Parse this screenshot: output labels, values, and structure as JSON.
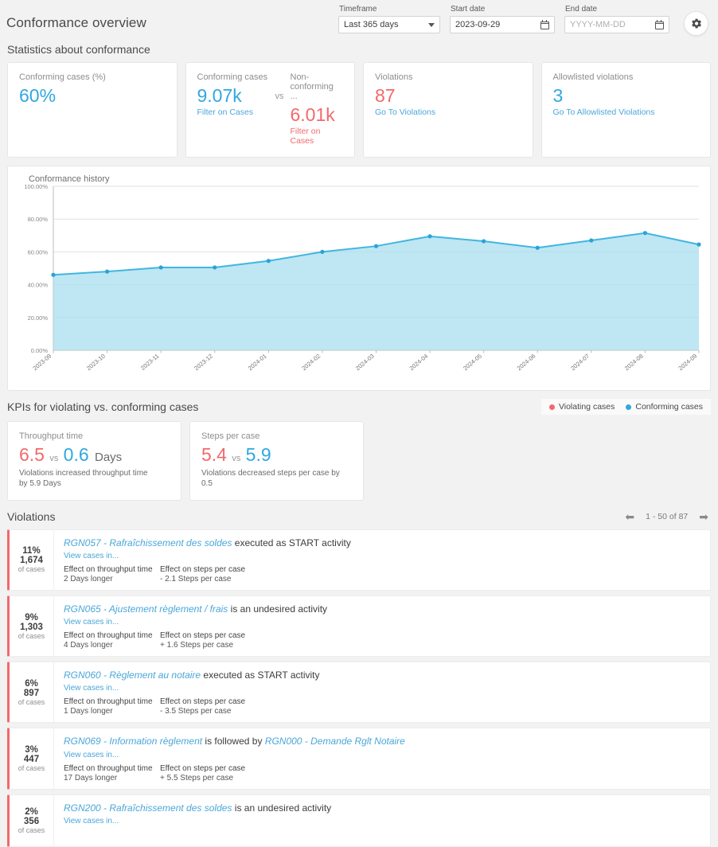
{
  "header": {
    "title": "Conformance overview",
    "timeframe": {
      "label": "Timeframe",
      "value": "Last 365 days"
    },
    "start_date": {
      "label": "Start date",
      "value": "2023-09-29",
      "placeholder": "YYYY-MM-DD"
    },
    "end_date": {
      "label": "End date",
      "value": "",
      "placeholder": "YYYY-MM-DD"
    },
    "settings_icon": "gear-icon"
  },
  "stats": {
    "title": "Statistics about conformance",
    "conforming_pct": {
      "label": "Conforming cases (%)",
      "value": "60%"
    },
    "conforming_cases": {
      "label": "Conforming cases",
      "value": "9.07k",
      "link": "Filter on Cases"
    },
    "vs": "vs",
    "non_conforming_cases": {
      "label": "Non-conforming ...",
      "value": "6.01k",
      "link": "Filter on Cases"
    },
    "violations": {
      "label": "Violations",
      "value": "87",
      "link": "Go To Violations"
    },
    "allowlisted": {
      "label": "Allowlisted violations",
      "value": "3",
      "link": "Go To Allowlisted Violations"
    }
  },
  "chart_data": {
    "type": "area",
    "title": "Conformance history",
    "xlabel": "",
    "ylabel": "",
    "ylim": [
      0,
      100
    ],
    "ytick_labels": [
      "0.00%",
      "20.00%",
      "40.00%",
      "60.00%",
      "80.00%",
      "100.00%"
    ],
    "yticks": [
      0,
      20,
      40,
      60,
      80,
      100
    ],
    "grid": true,
    "legend": "none",
    "categories": [
      "2023-09",
      "2023-10",
      "2023-11",
      "2023-12",
      "2024-01",
      "2024-02",
      "2024-03",
      "2024-04",
      "2024-05",
      "2024-06",
      "2024-07",
      "2024-08",
      "2024-09"
    ],
    "series": [
      {
        "name": "Conformance",
        "values": [
          46.0,
          48.0,
          50.5,
          50.5,
          54.5,
          60.0,
          63.5,
          69.5,
          66.5,
          62.5,
          67.0,
          71.5,
          64.5
        ]
      }
    ],
    "line_color": "#41b6e0",
    "fill_color": "#a9ddef"
  },
  "kpis": {
    "title": "KPIs for violating vs. conforming cases",
    "legend": [
      {
        "label": "Violating cases",
        "color": "#f2696b"
      },
      {
        "label": "Conforming cases",
        "color": "#2fa8e0"
      }
    ],
    "cards": [
      {
        "label": "Throughput time",
        "violating": "6.5",
        "vs": "vs",
        "conforming": "0.6",
        "unit": "Days",
        "note": "Violations increased throughput time by 5.9 Days"
      },
      {
        "label": "Steps per case",
        "violating": "5.4",
        "vs": "vs",
        "conforming": "5.9",
        "unit": "",
        "note": "Violations decreased steps per case by 0.5"
      }
    ]
  },
  "violations": {
    "title": "Violations",
    "pagination": {
      "prev_icon": "arrow-left-icon",
      "range": "1 - 50 of 87",
      "next_icon": "arrow-right-icon"
    },
    "view_cases_link": "View cases in...",
    "effect_throughput_header": "Effect on throughput time",
    "effect_steps_header": "Effect on steps per case",
    "items": [
      {
        "pct": "11%",
        "count": "1,674",
        "of_cases": "of cases",
        "rule": "RGN057 - Rafraîchissement des soldes",
        "desc_after": " executed as START activity",
        "rule2": "",
        "desc_mid": "",
        "throughput": "2 Days longer",
        "steps": "- 2.1 Steps per case"
      },
      {
        "pct": "9%",
        "count": "1,303",
        "of_cases": "of cases",
        "rule": "RGN065 - Ajustement règlement / frais",
        "desc_after": " is an undesired activity",
        "rule2": "",
        "desc_mid": "",
        "throughput": "4 Days longer",
        "steps": "+ 1.6 Steps per case"
      },
      {
        "pct": "6%",
        "count": "897",
        "of_cases": "of cases",
        "rule": "RGN060 - Règlement au notaire",
        "desc_after": " executed as START activity",
        "rule2": "",
        "desc_mid": "",
        "throughput": "1 Days longer",
        "steps": "- 3.5 Steps per case"
      },
      {
        "pct": "3%",
        "count": "447",
        "of_cases": "of cases",
        "rule": "RGN069 - Information règlement",
        "desc_mid": " is followed by ",
        "rule2": "RGN000 - Demande Rglt Notaire",
        "desc_after": "",
        "throughput": "17 Days longer",
        "steps": "+ 5.5 Steps per case"
      },
      {
        "pct": "2%",
        "count": "356",
        "of_cases": "of cases",
        "rule": "RGN200 - Rafraîchissement des soldes",
        "desc_after": " is an undesired activity",
        "rule2": "",
        "desc_mid": "",
        "throughput": "",
        "steps": ""
      }
    ]
  }
}
